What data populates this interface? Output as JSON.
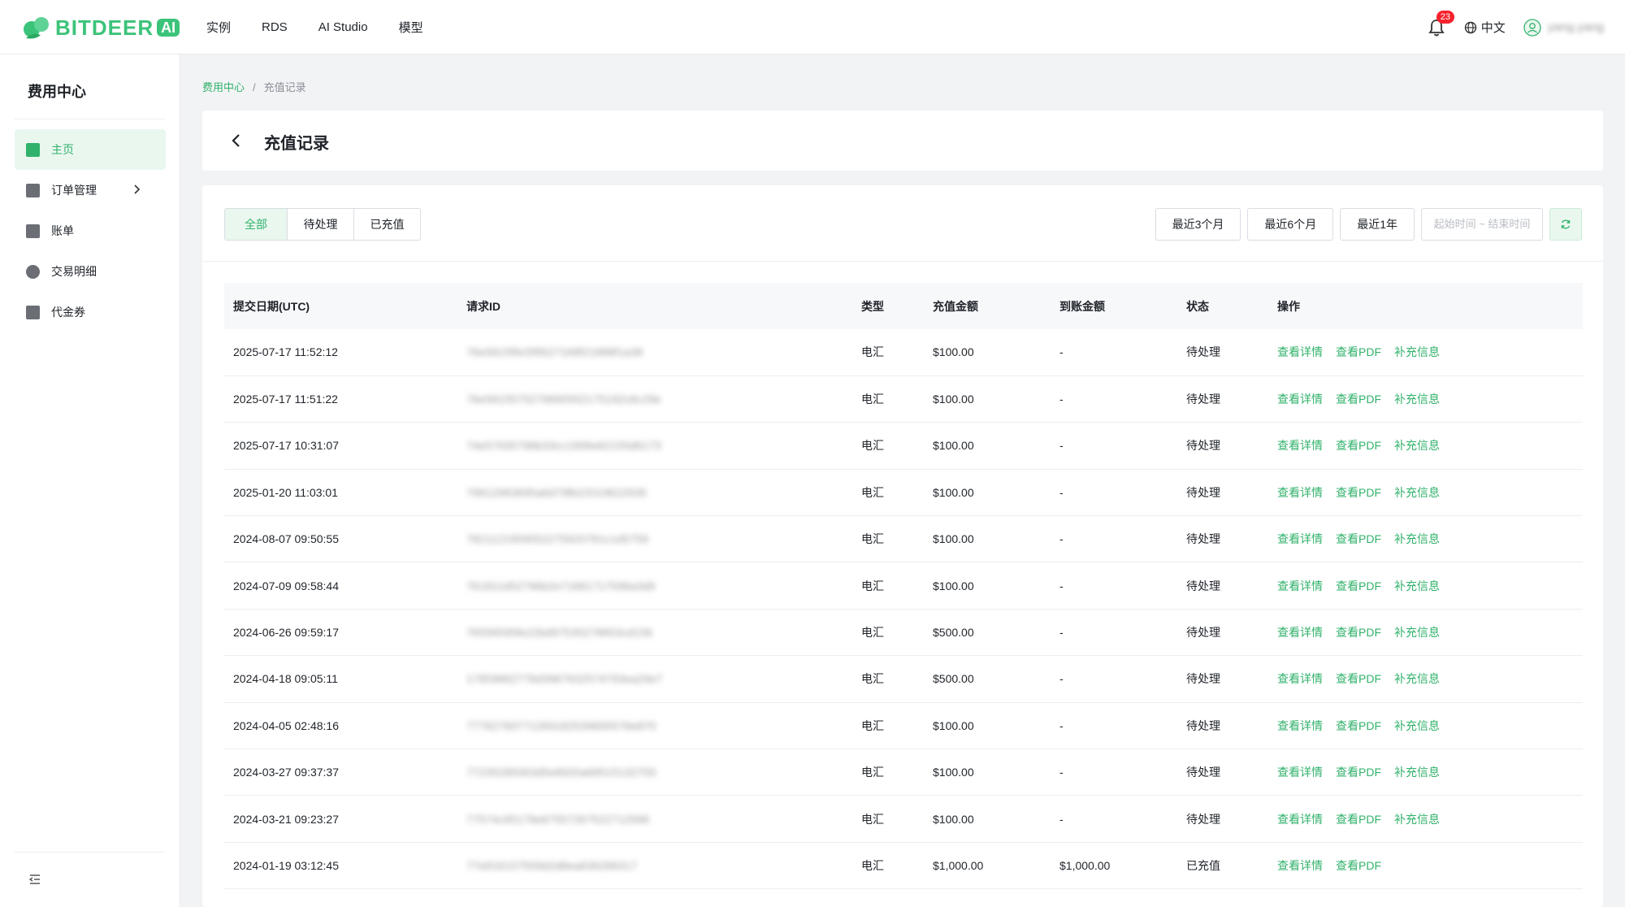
{
  "brand": {
    "name": "BITDEER",
    "suffix": "AI",
    "color": "#3cc37a"
  },
  "topnav": [
    "实例",
    "RDS",
    "AI Studio",
    "模型"
  ],
  "header": {
    "notification_count": "23",
    "language": "中文",
    "username": "yang.yang"
  },
  "sidebar": {
    "title": "费用中心",
    "items": [
      {
        "label": "主页",
        "icon": "dashboard-icon",
        "active": true
      },
      {
        "label": "订单管理",
        "icon": "order-icon",
        "has_children": true
      },
      {
        "label": "账单",
        "icon": "bill-icon"
      },
      {
        "label": "交易明细",
        "icon": "transaction-icon"
      },
      {
        "label": "代金券",
        "icon": "voucher-icon"
      }
    ]
  },
  "breadcrumb": {
    "parent": "费用中心",
    "current": "充值记录"
  },
  "page": {
    "title": "充值记录"
  },
  "filters": {
    "status_tabs": [
      "全部",
      "待处理",
      "已充值"
    ],
    "active_tab": "全部",
    "ranges": [
      "最近3个月",
      "最近6个月",
      "最近1年"
    ],
    "date_placeholder": "起始时间 ~ 结束时间"
  },
  "table": {
    "columns": [
      "提交日期(UTC)",
      "请求ID",
      "类型",
      "充值金额",
      "到账金额",
      "状态",
      "操作"
    ],
    "rows": [
      {
        "date": "2025-07-17 11:52:12",
        "id": "76e5815f9c5f9527168f21888f1a38",
        "type": "电汇",
        "amount": "$100.00",
        "received": "-",
        "status": "待处理",
        "actions": [
          "查看详情",
          "查看PDF",
          "补充信息"
        ]
      },
      {
        "date": "2025-07-17 11:51:22",
        "id": "76e5815575279690552175192c6c29e",
        "type": "电汇",
        "amount": "$100.00",
        "received": "-",
        "status": "待处理",
        "actions": [
          "查看详情",
          "查看PDF",
          "补充信息"
        ]
      },
      {
        "date": "2025-07-17 10:31:07",
        "id": "74e57935796b33cc1906e62155d6173",
        "type": "电汇",
        "amount": "$100.00",
        "received": "-",
        "status": "待处理",
        "actions": [
          "查看详情",
          "查看PDF",
          "补充信息"
        ]
      },
      {
        "date": "2025-01-20 11:03:01",
        "id": "79812983695a6d79fb22019622935",
        "type": "电汇",
        "amount": "$100.00",
        "received": "-",
        "status": "待处理",
        "actions": [
          "查看详情",
          "查看PDF",
          "补充信息"
        ]
      },
      {
        "date": "2024-08-07 09:50:55",
        "id": "7821121959052275920781c1d5759",
        "type": "电汇",
        "amount": "$100.00",
        "received": "-",
        "status": "待处理",
        "actions": [
          "查看详情",
          "查看PDF",
          "补充信息"
        ]
      },
      {
        "date": "2024-07-09 09:58:44",
        "id": "761811d52796b2e71681717596a3d9",
        "type": "电汇",
        "amount": "$100.00",
        "received": "-",
        "status": "待处理",
        "actions": [
          "查看详情",
          "查看PDF",
          "补充信息"
        ]
      },
      {
        "date": "2024-06-26 09:59:17",
        "id": "76556595fe22bd97535278653cd156",
        "type": "电汇",
        "amount": "$500.00",
        "received": "-",
        "status": "待处理",
        "actions": [
          "查看详情",
          "查看PDF",
          "补充信息"
        ]
      },
      {
        "date": "2024-04-18 09:05:11",
        "id": "17859862776d3967632574793ea29e7",
        "type": "电汇",
        "amount": "$500.00",
        "received": "-",
        "status": "待处理",
        "actions": [
          "查看详情",
          "查看PDF",
          "补充信息"
        ]
      },
      {
        "date": "2024-04-05 02:48:16",
        "id": "77762760771269182539695578e870",
        "type": "电汇",
        "amount": "$100.00",
        "received": "-",
        "status": "待处理",
        "actions": [
          "查看详情",
          "查看PDF",
          "补充信息"
        ]
      },
      {
        "date": "2024-03-27 09:37:37",
        "id": "77235285063d5e8920a68515132755",
        "type": "电汇",
        "amount": "$100.00",
        "received": "-",
        "status": "待处理",
        "actions": [
          "查看详情",
          "查看PDF",
          "补充信息"
        ]
      },
      {
        "date": "2024-03-21 09:23:27",
        "id": "77574c95178e87557267522712996",
        "type": "电汇",
        "amount": "$100.00",
        "received": "-",
        "status": "待处理",
        "actions": [
          "查看详情",
          "查看PDF",
          "补充信息"
        ]
      },
      {
        "date": "2024-01-19 03:12:45",
        "id": "77e816157559d2d8ea636286317",
        "type": "电汇",
        "amount": "$1,000.00",
        "received": "$1,000.00",
        "status": "已充值",
        "actions": [
          "查看详情",
          "查看PDF"
        ]
      }
    ]
  },
  "colors": {
    "accent": "#31b26b",
    "accent_bg": "#e9f7ef",
    "badge": "#f5222d"
  }
}
